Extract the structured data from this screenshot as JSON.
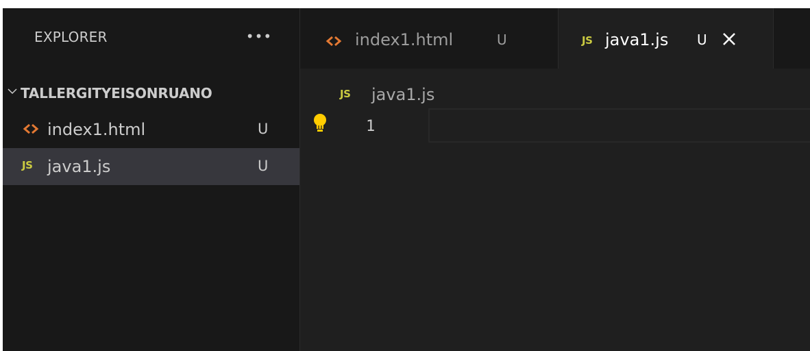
{
  "sidebar": {
    "title": "EXPLORER",
    "more_actions": "•••",
    "folder": {
      "name": "TALLERGITYEISONRUANO",
      "icon": "chevron-down-icon"
    },
    "files": [
      {
        "name": "index1.html",
        "status": "U",
        "icon": "html-file-icon",
        "active": false
      },
      {
        "name": "java1.js",
        "status": "U",
        "icon": "js-file-icon",
        "active": true
      }
    ]
  },
  "tabs": [
    {
      "label": "index1.html",
      "status": "U",
      "icon": "html-file-icon",
      "active": false
    },
    {
      "label": "java1.js",
      "status": "U",
      "icon": "js-file-icon",
      "active": true,
      "close_icon": "close-icon"
    }
  ],
  "breadcrumb": {
    "label": "java1.js",
    "icon": "js-file-icon"
  },
  "editor": {
    "line_number": "1",
    "lightbulb_icon": "lightbulb-icon"
  },
  "colors": {
    "html_icon": "#e37933",
    "js_icon": "#cbcb41",
    "lightbulb": "#ffcc00",
    "sidebar_bg": "#181818",
    "editor_bg": "#1f1f1f",
    "active_row": "#37373d"
  }
}
